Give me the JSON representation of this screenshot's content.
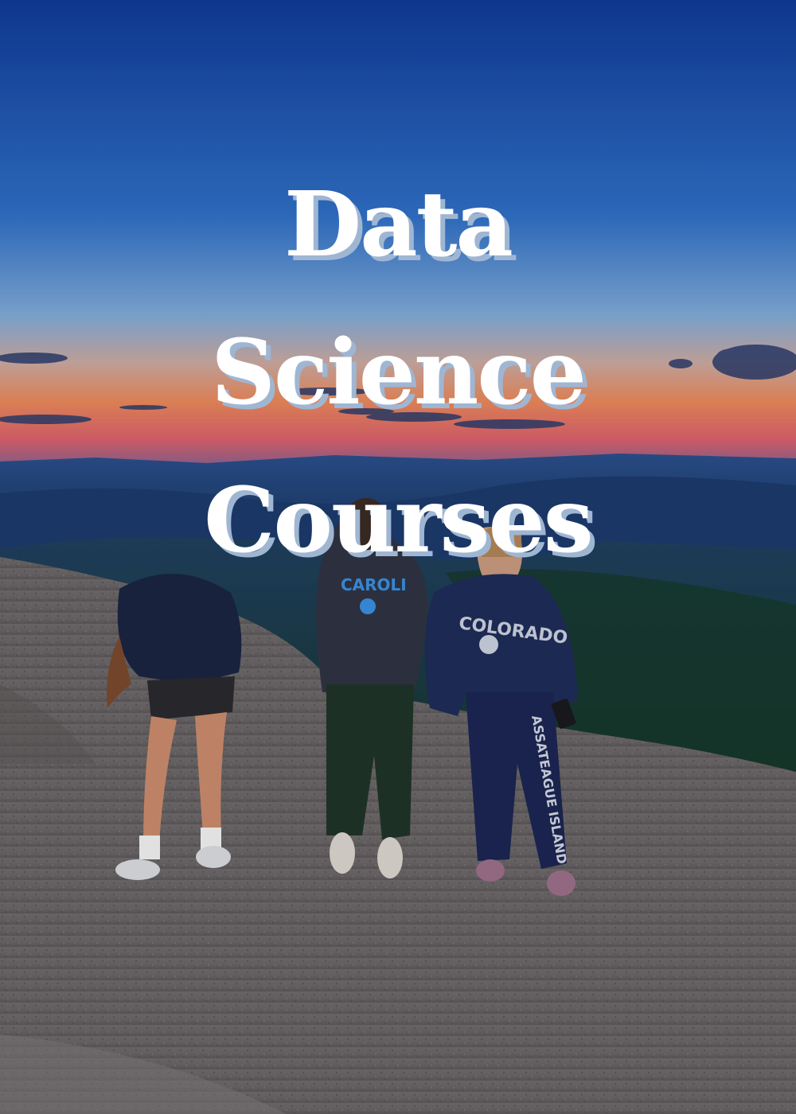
{
  "title": {
    "line1": "Data",
    "line2": "Science",
    "line3": "Courses"
  },
  "shirts": {
    "middle": "CAROLINA",
    "right": "COLORADO",
    "pants": "ASSATEAGUE ISLAND"
  },
  "colors": {
    "sky_top": "#123f9a",
    "sky_mid": "#3b74c4",
    "horizon_orange": "#e8885a",
    "horizon_pink": "#d9606a",
    "mountains": "#1d3d6e",
    "rock": "#6b6667",
    "title_text": "#ffffff",
    "title_shadow": "#9fb6d3"
  }
}
